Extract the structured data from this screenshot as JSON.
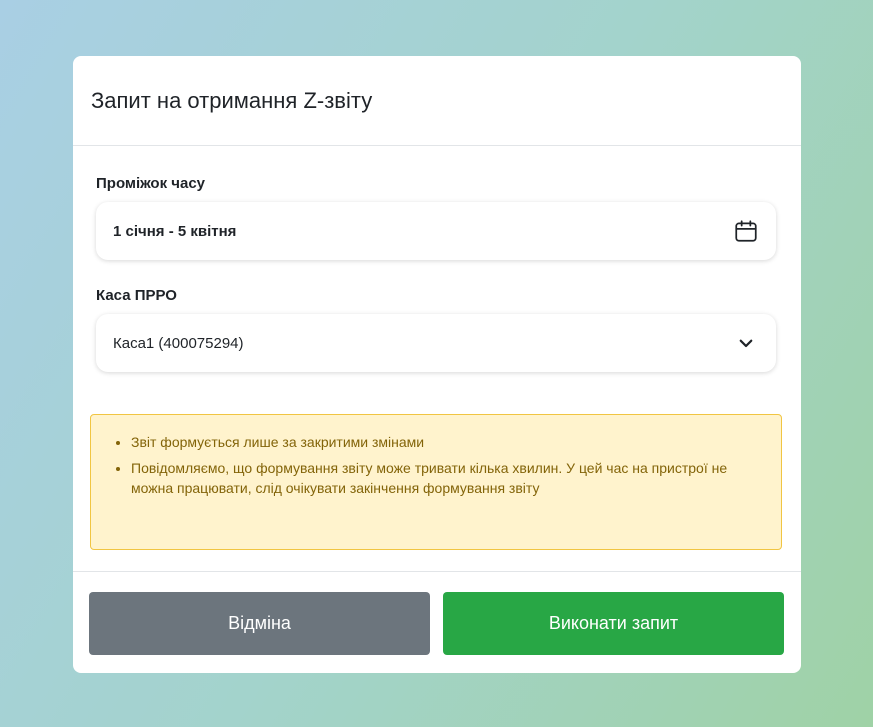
{
  "modal": {
    "title": "Запит на отримання Z-звіту"
  },
  "date_range": {
    "label": "Проміжок часу",
    "value": "1 січня - 5 квітня",
    "icon": "calendar-icon"
  },
  "register": {
    "label": "Каса ПРРО",
    "value": "Каса1 (400075294)",
    "icon": "chevron-down-icon"
  },
  "alert": {
    "items": [
      "Звіт формується лише за закритими змінами",
      "Повідомляємо, що формування звіту може тривати кілька хвилин. У цей час на пристрої не можна працювати, слід очікувати закінчення формування звіту"
    ],
    "background_color": "#fff3cd",
    "text_color": "#836409"
  },
  "footer": {
    "cancel_label": "Відміна",
    "submit_label": "Виконати запит",
    "cancel_color": "#6c757d",
    "submit_color": "#28a745"
  }
}
